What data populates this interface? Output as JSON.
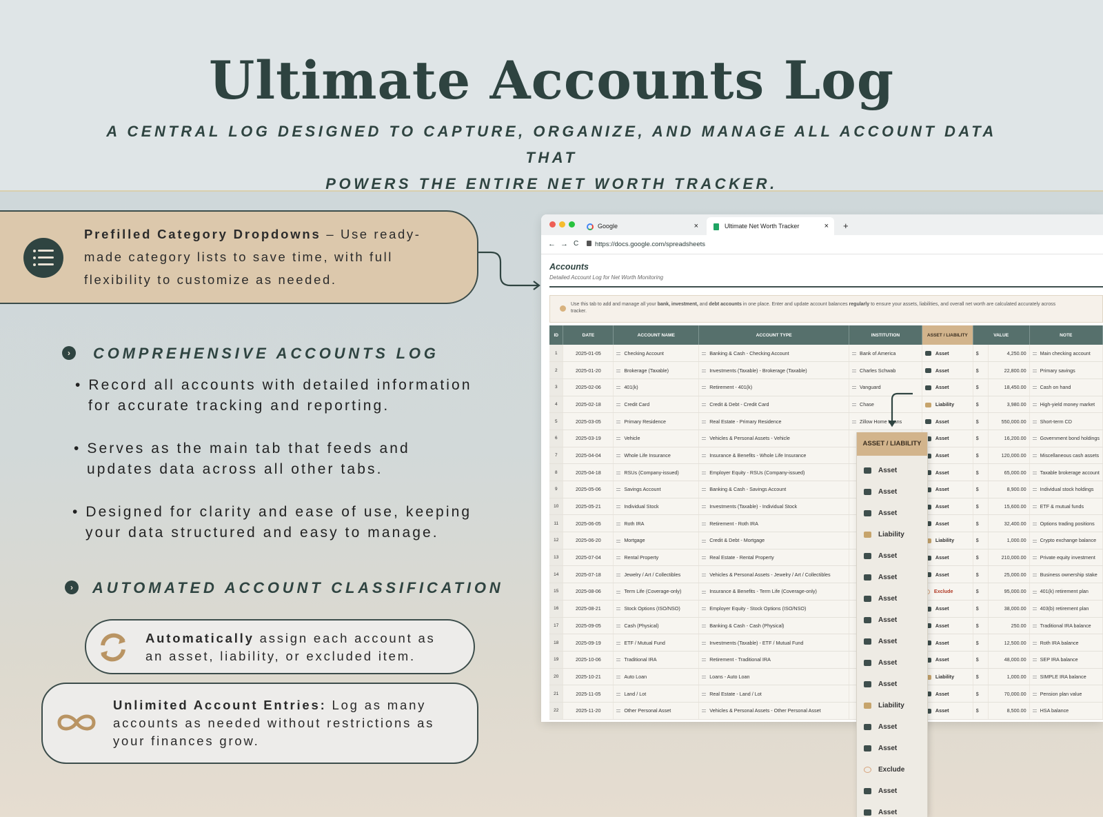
{
  "hero": {
    "title": "Ultimate Accounts Log",
    "subtitle_line1": "A CENTRAL LOG DESIGNED TO CAPTURE, ORGANIZE, AND MANAGE ALL ACCOUNT DATA THAT",
    "subtitle_line2": "POWERS THE ENTIRE NET WORTH TRACKER."
  },
  "callout": {
    "icon": "list-icon",
    "bold": "Prefilled Category Dropdowns",
    "text": " – Use ready-made category lists to save time, with full flexibility to customize as needed."
  },
  "sections": {
    "log": {
      "heading": "COMPREHENSIVE ACCOUNTS LOG",
      "bullets": [
        "• Record all accounts with detailed information",
        "for accurate tracking and reporting.",
        "• Serves as the main tab that feeds and",
        "updates data across all other tabs.",
        "• Designed for clarity and ease of use, keeping",
        "your data structured and easy to manage."
      ]
    },
    "auto": {
      "heading": "AUTOMATED ACCOUNT CLASSIFICATION",
      "pill1_bold": "Automatically",
      "pill1_text1": " assign each account as",
      "pill1_text2": "an asset, liability, or excluded item.",
      "pill2_bold": "Unlimited Account Entries:",
      "pill2_text1": " Log as many",
      "pill2_text2": "accounts as needed without restrictions as",
      "pill2_text3": "your finances grow."
    }
  },
  "browser": {
    "tab1": "Google",
    "tab2": "Ultimate Net Worth Tracker",
    "close": "×",
    "new_tab": "+",
    "url": "https://docs.google.com/spreadsheets",
    "nav_back": "←",
    "nav_fwd": "→",
    "nav_reload": "C"
  },
  "sheet": {
    "title": "Accounts",
    "subtitle": "Detailed Account Log for Net Worth Monitoring",
    "note_a": "Use this tab to add and manage all your ",
    "note_b": "bank, investment,",
    "note_c": " and ",
    "note_d": "debt accounts",
    "note_e": " in one place. Enter and update account balances ",
    "note_f": "regularly",
    "note_g": " to ensure your assets, liabilities, and overall net worth are calculated accurately across",
    "note_h": "tracker.",
    "columns": [
      "ID",
      "DATE",
      "ACCOUNT NAME",
      "ACCOUNT TYPE",
      "INSTITUTION",
      "ASSET / LIABILITY",
      "VALUE",
      "NOTE"
    ],
    "rows": [
      [
        "1",
        "2025-01-05",
        "Checking Account",
        "Banking & Cash - Checking Account",
        "Bank of America",
        "Asset",
        "$",
        "4,250.00",
        "Main checking account"
      ],
      [
        "2",
        "2025-01-20",
        "Brokerage (Taxable)",
        "Investments (Taxable) - Brokerage (Taxable)",
        "Charles Schwab",
        "Asset",
        "$",
        "22,800.00",
        "Primary savings"
      ],
      [
        "3",
        "2025-02-06",
        "401(k)",
        "Retirement - 401(k)",
        "Vanguard",
        "Asset",
        "$",
        "18,450.00",
        "Cash on hand"
      ],
      [
        "4",
        "2025-02-18",
        "Credit Card",
        "Credit & Debt - Credit Card",
        "Chase",
        "Liability",
        "$",
        "3,980.00",
        "High-yield money market"
      ],
      [
        "5",
        "2025-03-05",
        "Primary Residence",
        "Real Estate - Primary Residence",
        "Zillow Home Loans",
        "Asset",
        "$",
        "550,000.00",
        "Short-term CD"
      ],
      [
        "6",
        "2025-03-19",
        "Vehicle",
        "Vehicles & Personal Assets - Vehicle",
        "",
        "Asset",
        "$",
        "16,200.00",
        "Government bond holdings"
      ],
      [
        "7",
        "2025-04-04",
        "Whole Life Insurance",
        "Insurance & Benefits - Whole Life Insurance",
        "",
        "Asset",
        "$",
        "120,000.00",
        "Miscellaneous cash assets"
      ],
      [
        "8",
        "2025-04-18",
        "RSUs (Company-issued)",
        "Employer Equity - RSUs (Company-issued)",
        "",
        "Asset",
        "$",
        "65,000.00",
        "Taxable brokerage account"
      ],
      [
        "9",
        "2025-05-06",
        "Savings Account",
        "Banking & Cash - Savings Account",
        "",
        "Asset",
        "$",
        "8,900.00",
        "Individual stock holdings"
      ],
      [
        "10",
        "2025-05-21",
        "Individual Stock",
        "Investments (Taxable) - Individual Stock",
        "",
        "Asset",
        "$",
        "15,600.00",
        "ETF & mutual funds"
      ],
      [
        "11",
        "2025-06-05",
        "Roth IRA",
        "Retirement - Roth IRA",
        "",
        "Asset",
        "$",
        "32,400.00",
        "Options trading positions"
      ],
      [
        "12",
        "2025-06-20",
        "Mortgage",
        "Credit & Debt - Mortgage",
        "",
        "Liability",
        "$",
        "1,000.00",
        "Crypto exchange balance"
      ],
      [
        "13",
        "2025-07-04",
        "Rental Property",
        "Real Estate - Rental Property",
        "",
        "Asset",
        "$",
        "210,000.00",
        "Private equity investment"
      ],
      [
        "14",
        "2025-07-18",
        "Jewelry / Art / Collectibles",
        "Vehicles & Personal Assets - Jewelry / Art / Collectibles",
        "",
        "Asset",
        "$",
        "25,000.00",
        "Business ownership stake"
      ],
      [
        "15",
        "2025-08-06",
        "Term Life (Coverage-only)",
        "Insurance & Benefits - Term Life (Coverage-only)",
        "",
        "Exclude",
        "$",
        "95,000.00",
        "401(k) retirement plan"
      ],
      [
        "16",
        "2025-08-21",
        "Stock Options (ISO/NSO)",
        "Employer Equity - Stock Options (ISO/NSO)",
        "",
        "Asset",
        "$",
        "38,000.00",
        "403(b) retirement plan"
      ],
      [
        "17",
        "2025-09-05",
        "Cash (Physical)",
        "Banking & Cash - Cash (Physical)",
        "",
        "Asset",
        "$",
        "250.00",
        "Traditional IRA balance"
      ],
      [
        "18",
        "2025-09-19",
        "ETF / Mutual Fund",
        "Investments (Taxable) - ETF / Mutual Fund",
        "",
        "Asset",
        "$",
        "12,500.00",
        "Roth IRA balance"
      ],
      [
        "19",
        "2025-10-06",
        "Traditional IRA",
        "Retirement - Traditional IRA",
        "",
        "Asset",
        "$",
        "48,000.00",
        "SEP IRA balance"
      ],
      [
        "20",
        "2025-10-21",
        "Auto Loan",
        "Loans - Auto Loan",
        "",
        "Liability",
        "$",
        "1,000.00",
        "SIMPLE IRA balance"
      ],
      [
        "21",
        "2025-11-05",
        "Land / Lot",
        "Real Estate - Land / Lot",
        "",
        "Asset",
        "$",
        "70,000.00",
        "Pension plan value"
      ],
      [
        "22",
        "2025-11-20",
        "Other Personal Asset",
        "Vehicles & Personal Assets - Other Personal Asset",
        "",
        "Asset",
        "$",
        "8,500.00",
        "HSA balance"
      ]
    ]
  },
  "dropdown": {
    "header": "ASSET / LIABILITY",
    "items": [
      "Asset",
      "Asset",
      "Asset",
      "Liability",
      "Asset",
      "Asset",
      "Asset",
      "Asset",
      "Asset",
      "Asset",
      "Asset",
      "Liability",
      "Asset",
      "Asset",
      "Exclude",
      "Asset",
      "Asset"
    ]
  },
  "colors": {
    "dark_teal": "#2f4441",
    "tan": "#d2b48c",
    "callout_bg": "#dcc8ac",
    "exclude_red": "#b03a26"
  }
}
